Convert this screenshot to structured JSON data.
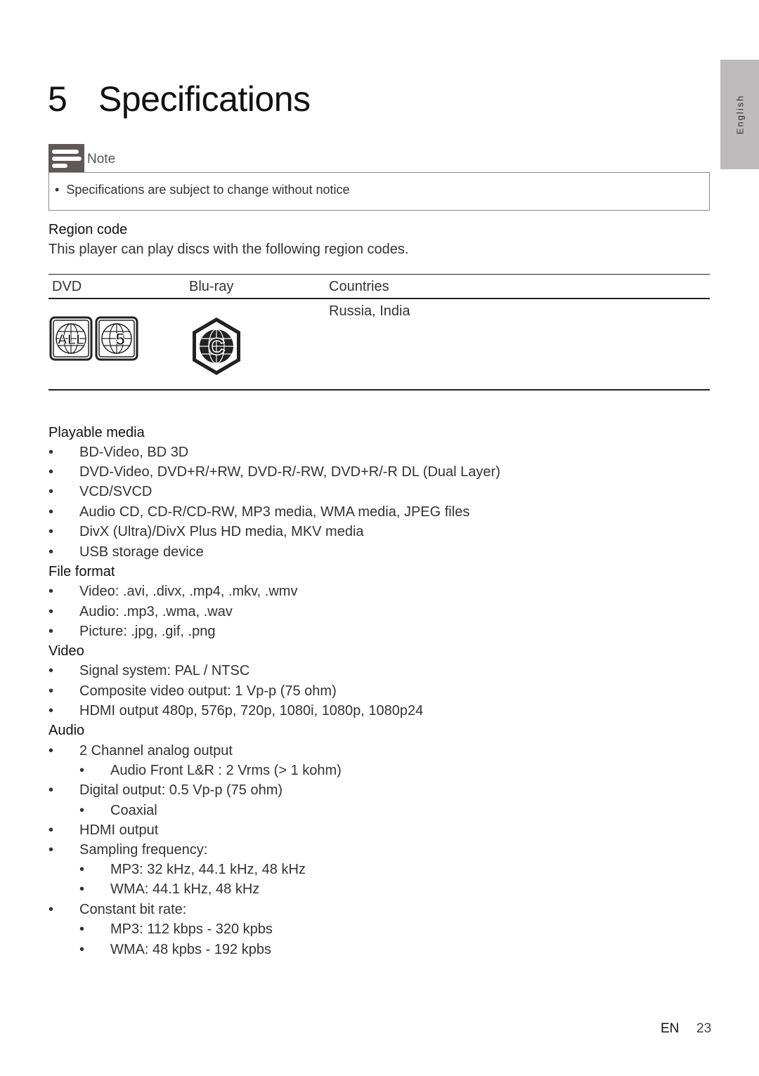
{
  "title": {
    "number": "5",
    "text": "Specifications"
  },
  "side_tab": {
    "label": "English",
    "color": "#bdbbbb"
  },
  "note": {
    "label": "Note",
    "icon": "note-icon",
    "items": [
      "Specifications are subject to change without notice"
    ]
  },
  "region": {
    "heading": "Region code",
    "description": "This player can play discs with the following region codes.",
    "table": {
      "headers": [
        "DVD",
        "Blu-ray",
        "Countries"
      ],
      "rows": [
        {
          "dvd_icons": [
            "region-all-icon",
            "region-5-icon"
          ],
          "dvd_icon_labels": [
            "ALL",
            "5"
          ],
          "bluray_icon": "region-c-icon",
          "bluray_icon_label": "C",
          "countries": "Russia, India"
        }
      ]
    }
  },
  "sections": [
    {
      "heading": "Playable media",
      "items": [
        {
          "text": "BD-Video, BD 3D",
          "level": 1
        },
        {
          "text": "DVD-Video, DVD+R/+RW, DVD-R/-RW, DVD+R/-R DL (Dual Layer)",
          "level": 1
        },
        {
          "text": "VCD/SVCD",
          "level": 1
        },
        {
          "text": "Audio CD, CD-R/CD-RW, MP3 media, WMA media, JPEG files",
          "level": 1
        },
        {
          "text": "DivX (Ultra)/DivX Plus HD media, MKV media",
          "level": 1
        },
        {
          "text": "USB storage device",
          "level": 1
        }
      ]
    },
    {
      "heading": "File format",
      "items": [
        {
          "text": "Video: .avi, .divx, .mp4, .mkv, .wmv",
          "level": 1
        },
        {
          "text": "Audio: .mp3, .wma, .wav",
          "level": 1
        },
        {
          "text": "Picture: .jpg, .gif, .png",
          "level": 1
        }
      ]
    },
    {
      "heading": "Video",
      "items": [
        {
          "text": "Signal system: PAL / NTSC",
          "level": 1
        },
        {
          "text": "Composite video output: 1 Vp-p (75 ohm)",
          "level": 1
        },
        {
          "text": "HDMI output 480p, 576p, 720p, 1080i, 1080p, 1080p24",
          "level": 1
        }
      ]
    },
    {
      "heading": "Audio",
      "items": [
        {
          "text": "2 Channel analog output",
          "level": 1
        },
        {
          "text": "Audio Front L&R : 2 Vrms (> 1 kohm)",
          "level": 2
        },
        {
          "text": "Digital output: 0.5 Vp-p (75 ohm)",
          "level": 1
        },
        {
          "text": "Coaxial",
          "level": 2
        },
        {
          "text": "HDMI output",
          "level": 1
        },
        {
          "text": "Sampling frequency:",
          "level": 1
        },
        {
          "text": "MP3: 32 kHz, 44.1 kHz, 48 kHz",
          "level": 2
        },
        {
          "text": "WMA: 44.1 kHz, 48 kHz",
          "level": 2
        },
        {
          "text": "Constant bit rate:",
          "level": 1
        },
        {
          "text": "MP3: 112 kbps - 320 kpbs",
          "level": 2
        },
        {
          "text": "WMA: 48 kpbs - 192 kpbs",
          "level": 2
        }
      ]
    }
  ],
  "bullet_char": "•",
  "footer": {
    "lang": "EN",
    "page": "23"
  }
}
